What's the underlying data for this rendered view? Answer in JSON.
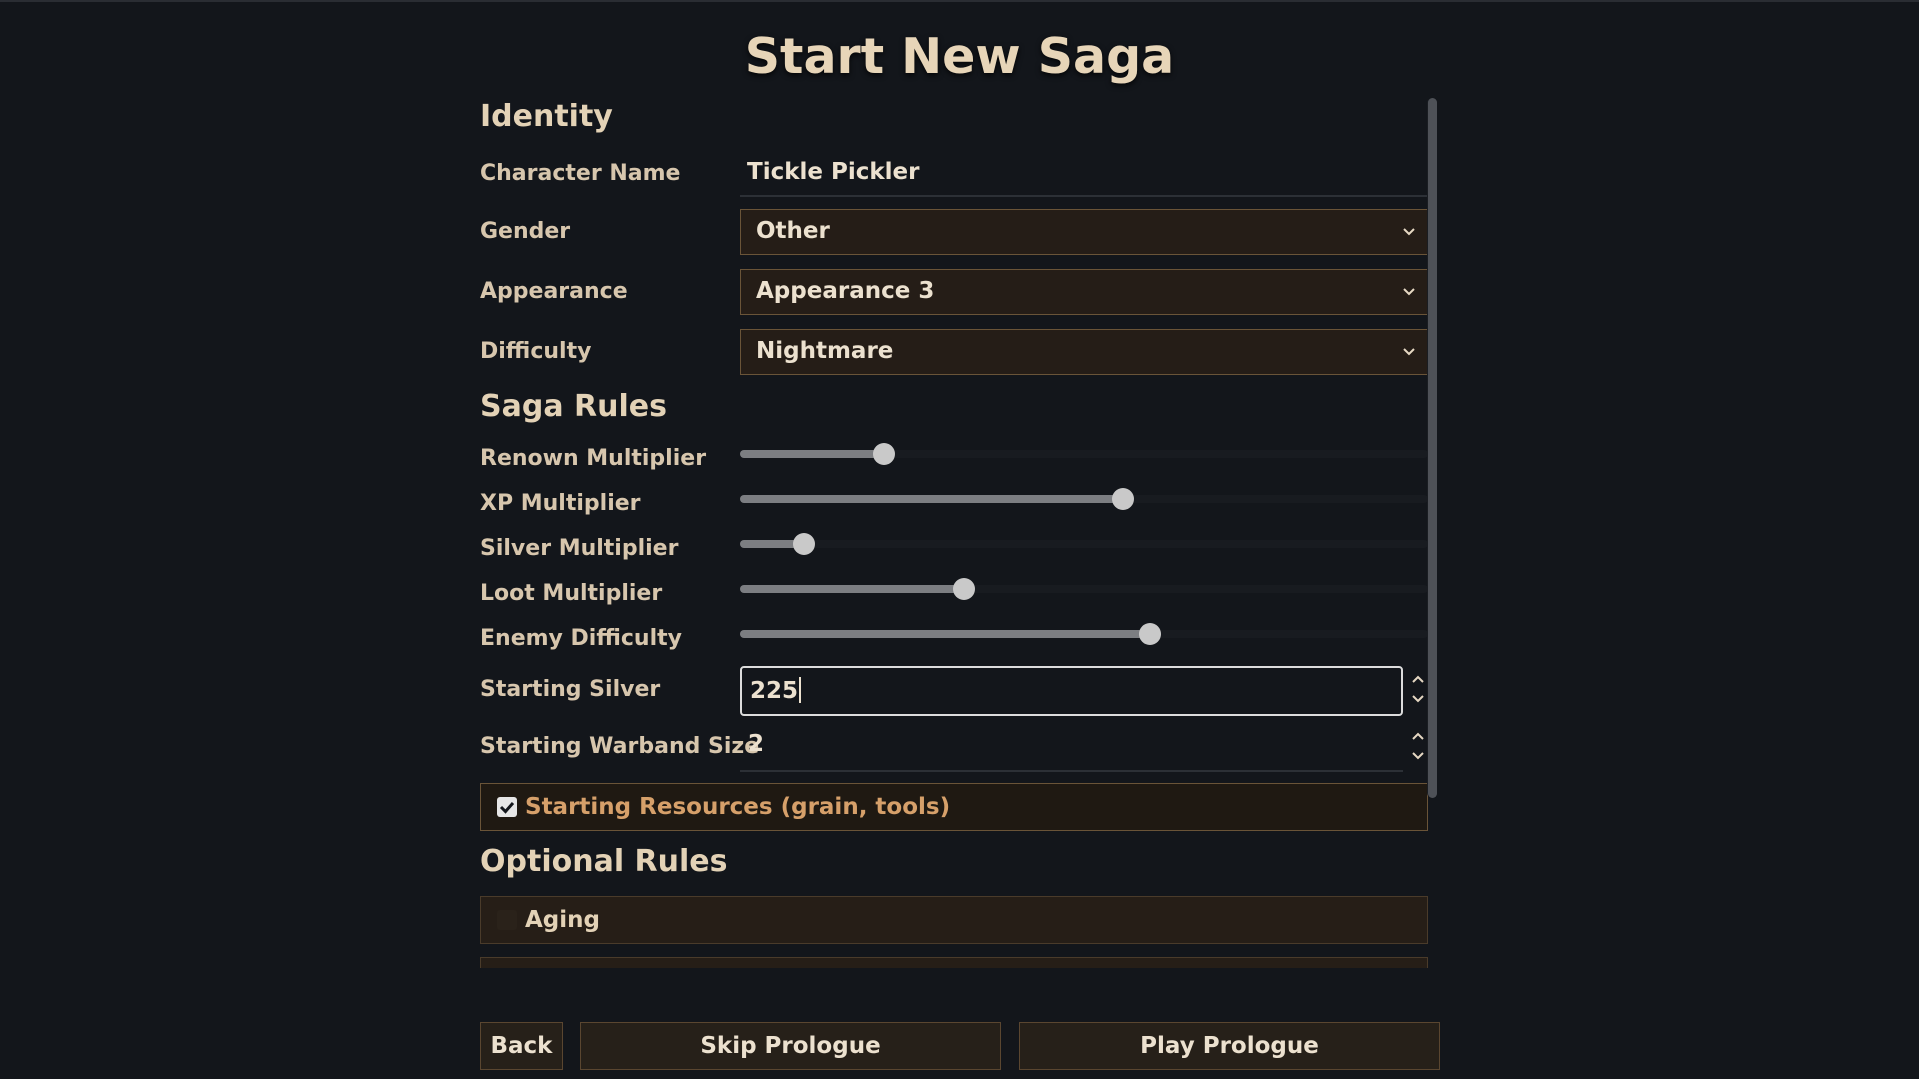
{
  "title": "Start New Saga",
  "identity": {
    "heading": "Identity",
    "character_name_label": "Character Name",
    "character_name_value": "Tickle Pickler",
    "gender_label": "Gender",
    "gender_value": "Other",
    "appearance_label": "Appearance",
    "appearance_value": "Appearance 3",
    "difficulty_label": "Difficulty",
    "difficulty_value": "Nightmare"
  },
  "saga_rules": {
    "heading": "Saga Rules",
    "sliders": [
      {
        "label": "Renown Multiplier",
        "level": 0.21
      },
      {
        "label": "XP Multiplier",
        "level": 0.557
      },
      {
        "label": "Silver Multiplier",
        "level": 0.093
      },
      {
        "label": "Loot Multiplier",
        "level": 0.325
      },
      {
        "label": "Enemy Difficulty",
        "level": 0.596
      }
    ],
    "starting_silver_label": "Starting Silver",
    "starting_silver_value": "225",
    "starting_warband_label": "Starting Warband Size",
    "starting_warband_value": "2",
    "starting_resources_label": "Starting Resources (grain, tools)",
    "starting_resources_checked": true
  },
  "optional_rules": {
    "heading": "Optional Rules",
    "items": [
      {
        "label": "Aging",
        "checked": false
      }
    ]
  },
  "buttons": {
    "back": "Back",
    "skip_prologue": "Skip Prologue",
    "play_prologue": "Play Prologue"
  },
  "colors": {
    "background": "#13161b",
    "accent_border": "#6a5438",
    "checkbox_text": "#d6a06a"
  }
}
